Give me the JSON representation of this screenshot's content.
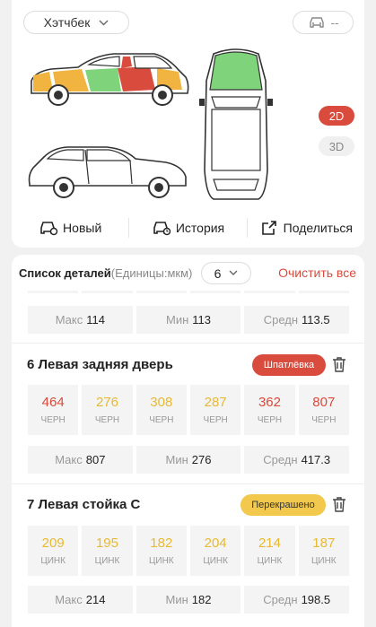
{
  "top": {
    "body_type": "Хэтчбек",
    "car_status": "--",
    "views": [
      "2D",
      "3D"
    ],
    "actions": [
      {
        "label": "Новый",
        "icon": "car-new-icon"
      },
      {
        "label": "История",
        "icon": "car-history-icon"
      },
      {
        "label": "Поделиться",
        "icon": "share-icon"
      }
    ]
  },
  "colors": {
    "accent": "#d94b3c",
    "yellow": "#e8b931",
    "paint_yellow": "#f2c94c",
    "green": "#7fd37a",
    "orange": "#f2b441"
  },
  "list": {
    "title": "Список деталей",
    "unit": "(Единицы:мкм)",
    "count": "6",
    "clear_label": "Очистить все",
    "prev_stats": {
      "max_label": "Макс",
      "max": "114",
      "min_label": "Мин",
      "min": "113",
      "avg_label": "Средн",
      "avg": "113.5"
    },
    "parts": [
      {
        "title": "6 Левая задняя дверь",
        "badge": "Шпатлёвка",
        "readings": [
          {
            "value": "464",
            "type": "ЧЕРН",
            "color": "#d94b3c"
          },
          {
            "value": "276",
            "type": "ЧЕРН",
            "color": "#e8b931"
          },
          {
            "value": "308",
            "type": "ЧЕРН",
            "color": "#e8b931"
          },
          {
            "value": "287",
            "type": "ЧЕРН",
            "color": "#e8b931"
          },
          {
            "value": "362",
            "type": "ЧЕРН",
            "color": "#d94b3c"
          },
          {
            "value": "807",
            "type": "ЧЕРН",
            "color": "#d94b3c"
          }
        ],
        "stats": {
          "max_label": "Макс",
          "max": "807",
          "min_label": "Мин",
          "min": "276",
          "avg_label": "Средн",
          "avg": "417.3"
        }
      },
      {
        "title": "7 Левая стойка C",
        "badge": "Перекрашено",
        "readings": [
          {
            "value": "209",
            "type": "ЦИНК",
            "color": "#e8b931"
          },
          {
            "value": "195",
            "type": "ЦИНК",
            "color": "#e8b931"
          },
          {
            "value": "182",
            "type": "ЦИНК",
            "color": "#e8b931"
          },
          {
            "value": "204",
            "type": "ЦИНК",
            "color": "#e8b931"
          },
          {
            "value": "214",
            "type": "ЦИНК",
            "color": "#e8b931"
          },
          {
            "value": "187",
            "type": "ЦИНК",
            "color": "#e8b931"
          }
        ],
        "stats": {
          "max_label": "Макс",
          "max": "214",
          "min_label": "Мин",
          "min": "182",
          "avg_label": "Средн",
          "avg": "198.5"
        }
      }
    ]
  }
}
